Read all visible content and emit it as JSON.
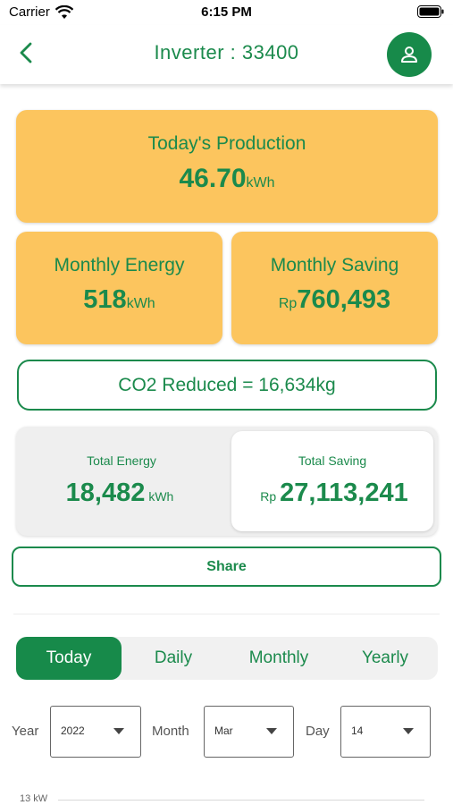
{
  "status_bar": {
    "carrier": "Carrier",
    "time": "6:15 PM"
  },
  "header": {
    "title": "Inverter : 33400"
  },
  "today_production": {
    "label": "Today's Production",
    "value": "46.70",
    "unit": "kWh"
  },
  "monthly_energy": {
    "label": "Monthly Energy",
    "value": "518",
    "unit": "kWh"
  },
  "monthly_saving": {
    "label": "Monthly Saving",
    "currency": "Rp",
    "value": "760,493"
  },
  "co2": {
    "text": "CO2 Reduced = 16,634kg"
  },
  "total_energy": {
    "label": "Total Energy",
    "value": "18,482",
    "unit": "kWh"
  },
  "total_saving": {
    "label": "Total Saving",
    "currency": "Rp",
    "value": "27,113,241"
  },
  "share": {
    "label": "Share"
  },
  "tabs": [
    {
      "label": "Today",
      "active": true
    },
    {
      "label": "Daily",
      "active": false
    },
    {
      "label": "Monthly",
      "active": false
    },
    {
      "label": "Yearly",
      "active": false
    }
  ],
  "filters": {
    "year": {
      "label": "Year",
      "value": "2022"
    },
    "month": {
      "label": "Month",
      "value": "Mar"
    },
    "day": {
      "label": "Day",
      "value": "14"
    }
  },
  "chart": {
    "y_max_label": "13 kW"
  },
  "colors": {
    "primary_green": "#178a4a",
    "card_yellow": "#fcc55e"
  }
}
